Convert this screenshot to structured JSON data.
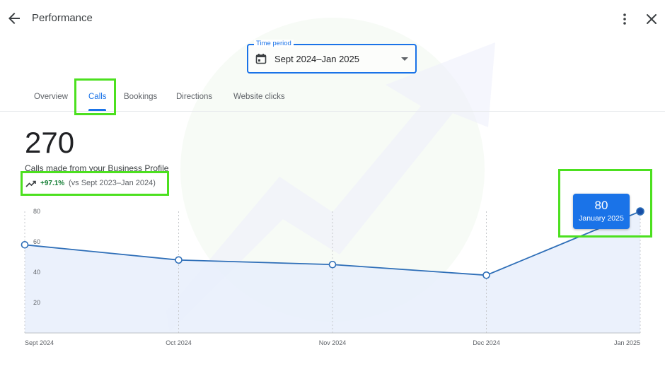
{
  "header": {
    "title": "Performance"
  },
  "time_period": {
    "label": "Time period",
    "value": "Sept 2024–Jan 2025"
  },
  "tabs": [
    {
      "label": "Overview",
      "active": false
    },
    {
      "label": "Calls",
      "active": true
    },
    {
      "label": "Bookings",
      "active": false
    },
    {
      "label": "Directions",
      "active": false
    },
    {
      "label": "Website clicks",
      "active": false
    }
  ],
  "summary": {
    "total": "270",
    "description": "Calls made from your Business Profile",
    "change": "+97.1%",
    "comparison": "(vs Sept 2023–Jan 2024)"
  },
  "tooltip": {
    "value": "80",
    "date": "January 2025"
  },
  "colors": {
    "accent": "#1a73e8",
    "line": "#2f6fb8",
    "area": "#e8effc",
    "positive": "#188038",
    "highlight": "#4ce01f"
  },
  "chart_data": {
    "type": "area",
    "x": [
      "Sept 2024",
      "Oct 2024",
      "Nov 2024",
      "Dec 2024",
      "Jan 2025"
    ],
    "values": [
      58,
      48,
      45,
      38,
      80
    ],
    "yticks": [
      20,
      40,
      60,
      80
    ],
    "ylim": [
      0,
      80
    ],
    "grid": true
  }
}
